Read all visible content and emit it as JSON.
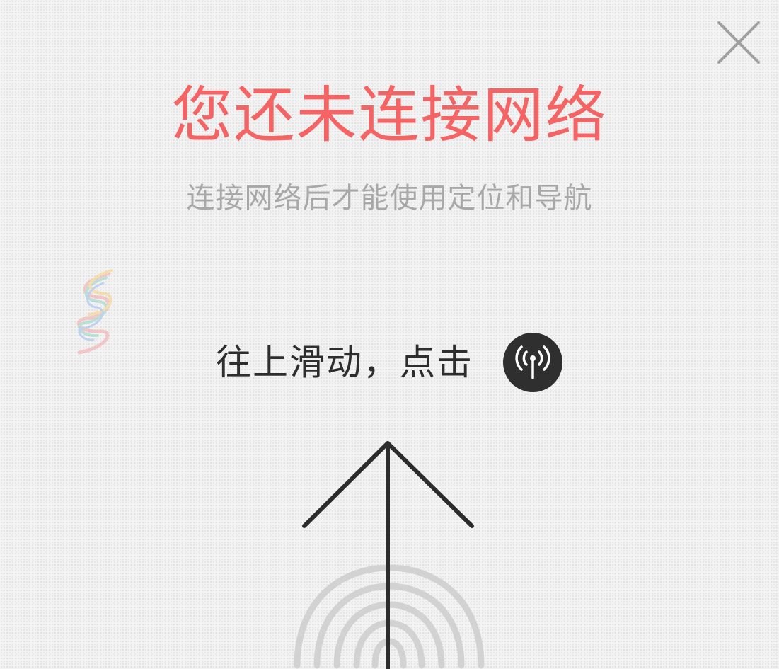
{
  "dialog": {
    "title": "您还未连接网络",
    "subtitle": "连接网络后才能使用定位和导航",
    "instruction": "往上滑动，点击"
  },
  "icons": {
    "close": "close-icon",
    "wifi": "wifi-antenna-icon",
    "arrow": "arrow-up-icon",
    "fingerprint": "fingerprint-icon",
    "decoration": "color-squiggle-icon"
  },
  "colors": {
    "title": "#f46464",
    "subtitle": "#a8a8a8",
    "instruction": "#2e2e2e",
    "wifi_button_bg": "#2f2f2f",
    "background": "#f3f3f3"
  }
}
